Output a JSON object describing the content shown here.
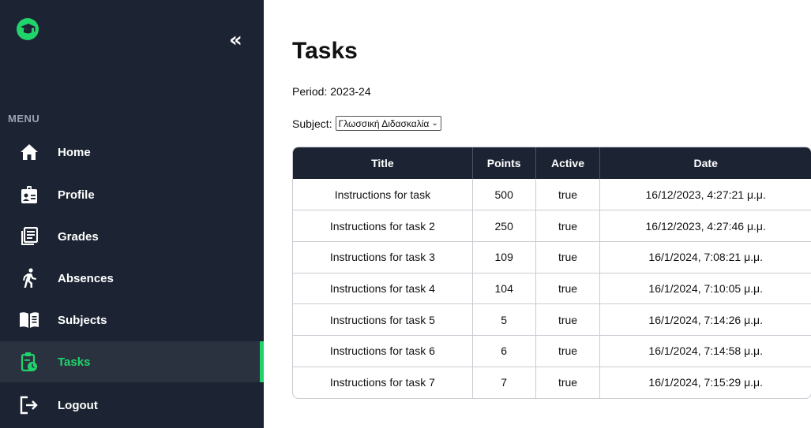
{
  "sidebar": {
    "menu_label": "MENU",
    "collapse_icon": "double-chevron-left",
    "items": [
      {
        "label": "Home",
        "icon": "home-icon"
      },
      {
        "label": "Profile",
        "icon": "id-badge-icon"
      },
      {
        "label": "Grades",
        "icon": "document-icon"
      },
      {
        "label": "Absences",
        "icon": "running-person-icon"
      },
      {
        "label": "Subjects",
        "icon": "open-book-icon"
      },
      {
        "label": "Tasks",
        "icon": "clipboard-clock-icon",
        "active": true
      },
      {
        "label": "Logout",
        "icon": "logout-icon"
      }
    ]
  },
  "colors": {
    "sidebar_bg": "#1c2433",
    "accent": "#20d46b",
    "header_bg": "#1c2433"
  },
  "page": {
    "title": "Tasks",
    "period": "Period: 2023-24",
    "subject_label": "Subject:",
    "subject_value": "Γλωσσική Διδασκαλία"
  },
  "table": {
    "headers": [
      "Title",
      "Points",
      "Active",
      "Date"
    ],
    "rows": [
      [
        "Instructions for task",
        "500",
        "true",
        "16/12/2023, 4:27:21 μ.μ."
      ],
      [
        "Instructions for task 2",
        "250",
        "true",
        "16/12/2023, 4:27:46 μ.μ."
      ],
      [
        "Instructions for task 3",
        "109",
        "true",
        "16/1/2024, 7:08:21 μ.μ."
      ],
      [
        "Instructions for task 4",
        "104",
        "true",
        "16/1/2024, 7:10:05 μ.μ."
      ],
      [
        "Instructions for task 5",
        "5",
        "true",
        "16/1/2024, 7:14:26 μ.μ."
      ],
      [
        "Instructions for task 6",
        "6",
        "true",
        "16/1/2024, 7:14:58 μ.μ."
      ],
      [
        "Instructions for task 7",
        "7",
        "true",
        "16/1/2024, 7:15:29 μ.μ."
      ]
    ]
  }
}
